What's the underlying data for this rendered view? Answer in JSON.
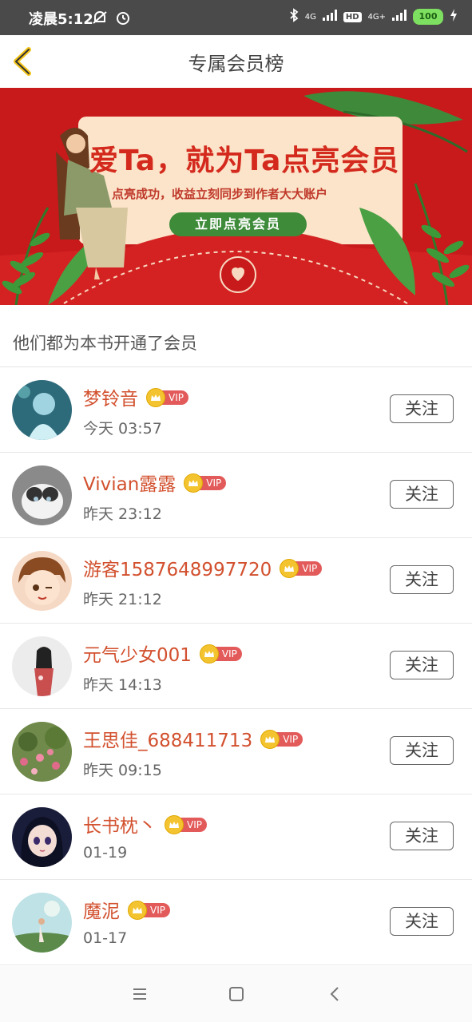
{
  "status_bar": {
    "time": "凌晨5:12",
    "battery": "100",
    "hd_label": "HD",
    "signal1_label": "4G",
    "signal2_label": "4G+"
  },
  "header": {
    "title": "专属会员榜",
    "back_icon": "back-chevron-icon"
  },
  "banner": {
    "title": "爱Ta，就为Ta点亮会员",
    "subtitle": "点亮成功，收益立刻同步到作者大大账户",
    "button_label": "立即点亮会员"
  },
  "section": {
    "title": "他们都为本书开通了会员"
  },
  "vip_label": "VIP",
  "follow_label": "关注",
  "members": [
    {
      "name": "梦铃音",
      "time": "今天 03:57"
    },
    {
      "name": "Vivian露露",
      "time": "昨天 23:12"
    },
    {
      "name": "游客1587648997720",
      "time": "昨天 21:12"
    },
    {
      "name": "元气少女001",
      "time": "昨天 14:13"
    },
    {
      "name": "王思佳_688411713",
      "time": "昨天 09:15"
    },
    {
      "name": "长书枕丶",
      "time": "01-19"
    },
    {
      "name": "魔泥",
      "time": "01-17"
    }
  ],
  "colors": {
    "accent": "#d2502e",
    "banner_red": "#c8191b",
    "banner_button": "#3e8b3a",
    "vip_badge": "#e35a5a",
    "crown": "#f4c430"
  },
  "nav": {
    "menu_icon": "menu-icon",
    "home_icon": "home-square-icon",
    "back_icon": "back-icon"
  }
}
